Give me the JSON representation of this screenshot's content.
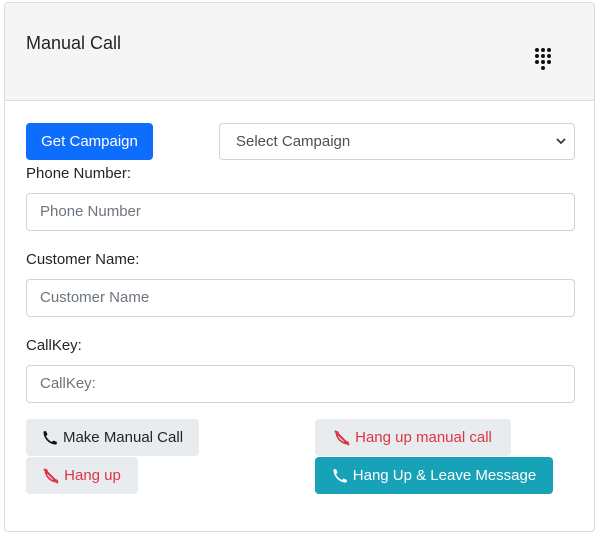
{
  "card": {
    "title": "Manual Call"
  },
  "campaign": {
    "get_button_label": "Get Campaign",
    "select_value": "Select Campaign"
  },
  "fields": {
    "phone_label": "Phone Number:",
    "phone_placeholder": "Phone Number",
    "name_label": "Customer Name:",
    "name_placeholder": "Customer Name",
    "callkey_label": "CallKey:",
    "callkey_placeholder": "CallKey:"
  },
  "actions": {
    "make_call_label": "Make Manual Call",
    "hangup_manual_label": "Hang up manual call",
    "hangup_label": "Hang up",
    "hangup_leave_label": "Hang Up & Leave Message"
  },
  "icons": {
    "header": "dialpad-icon",
    "call": "phone-icon",
    "hangup": "phone-slash-icon"
  },
  "colors": {
    "primary": "#0d6efd",
    "info": "#17a2b8",
    "danger": "#dc3545",
    "light": "#e9ecef"
  }
}
